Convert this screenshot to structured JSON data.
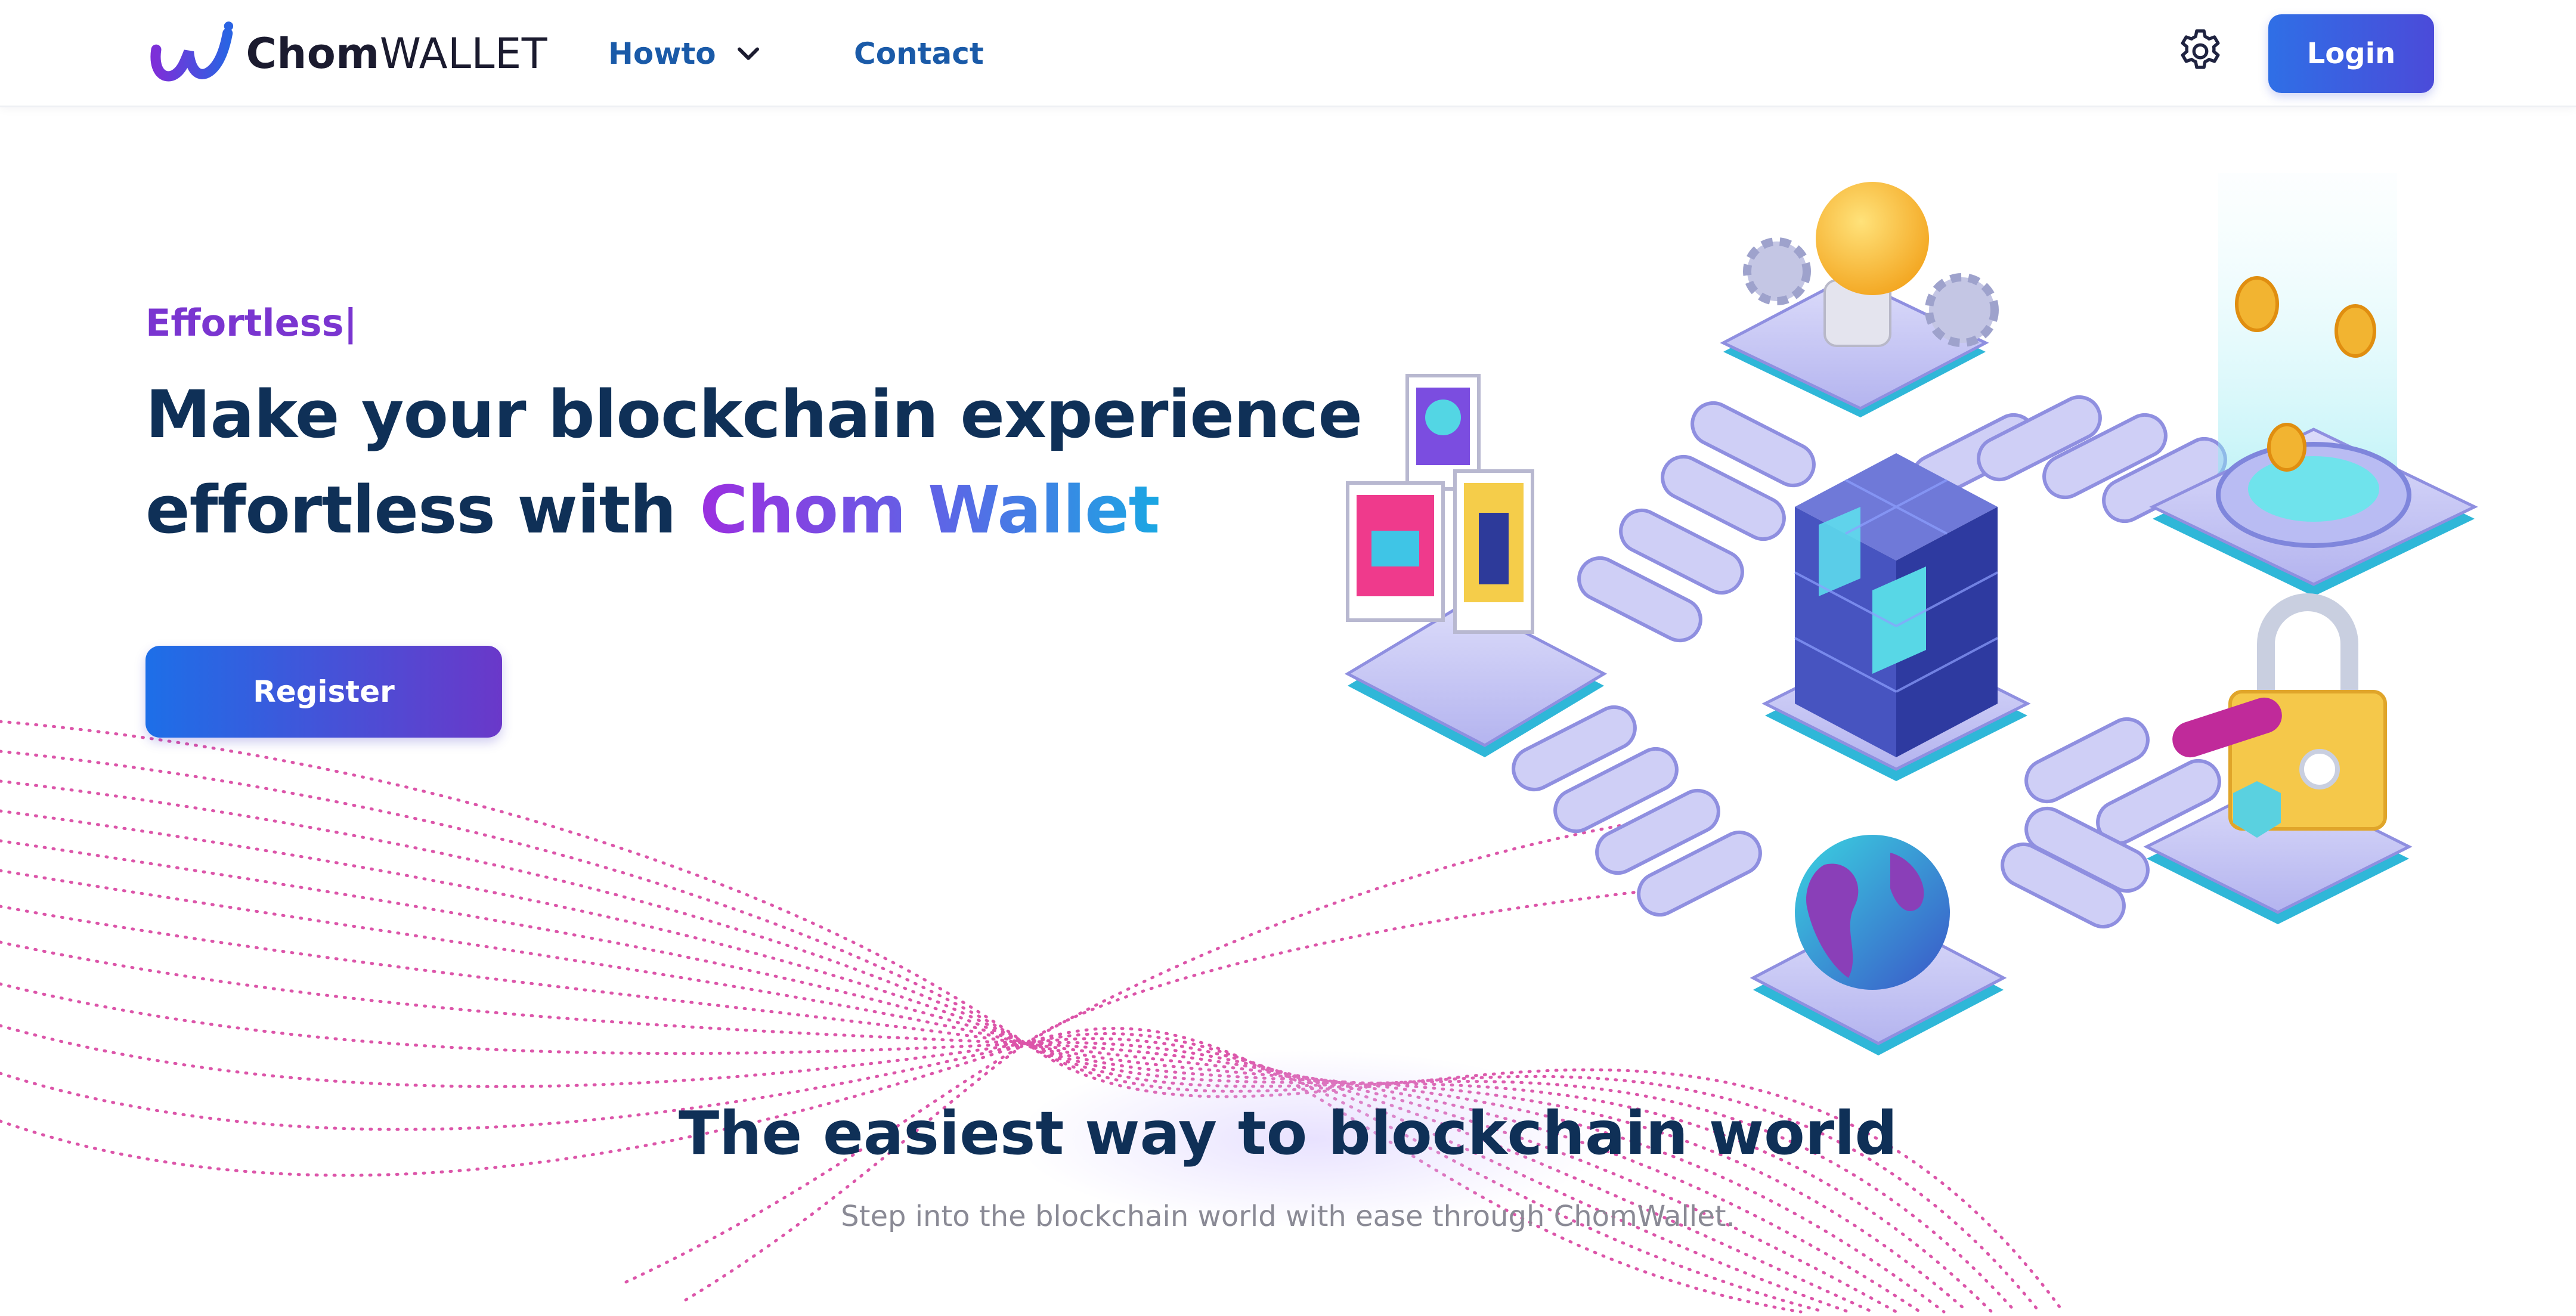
{
  "header": {
    "logo": {
      "strong": "Chom",
      "light": "WALLET"
    },
    "nav": [
      {
        "label": "Howto",
        "has_dropdown": true,
        "icon": "chevron-down-icon"
      },
      {
        "label": "Contact"
      }
    ],
    "settings_icon": "gear-icon",
    "login_label": "Login"
  },
  "hero": {
    "tagline": "Effortless|",
    "headline_line1": "Make your blockchain experience",
    "headline_line2_prefix": "effortless with",
    "headline_brand": "Chom Wallet",
    "register_label": "Register"
  },
  "section": {
    "title": "The easiest way to blockchain world",
    "subtitle": "Step into the blockchain world with ease through ChomWallet."
  },
  "colors": {
    "primary_text": "#0f3057",
    "nav_link": "#1a5aa8",
    "tagline": "#7a35d0",
    "button_gradient_start": "#1d6fe8",
    "button_gradient_end": "#6a38c9",
    "brand_gradient": [
      "#9b2fe0",
      "#5a68e6",
      "#1aa7e3"
    ],
    "wave_dots": "#d6389b"
  }
}
